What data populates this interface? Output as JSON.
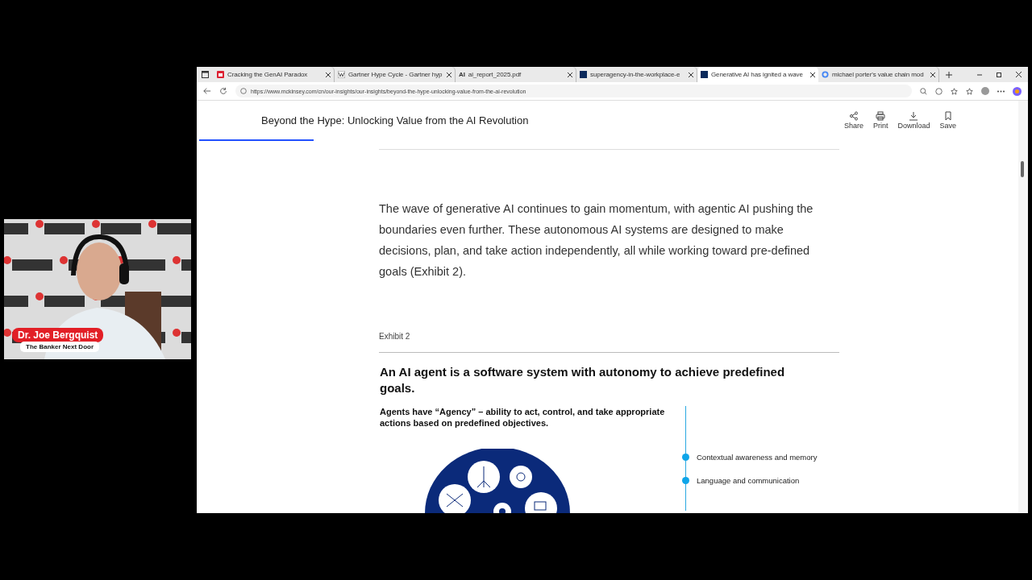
{
  "webcam": {
    "kind": "picture",
    "name": "Dr. Joe Bergquist",
    "show": "The Banker Next Door"
  },
  "browser": {
    "tabs": [
      {
        "title": "Cracking the GenAI Paradox",
        "kind": "pdf",
        "selected": false
      },
      {
        "title": "Gartner Hype Cycle - Gartner hyp",
        "kind": "wiki",
        "selected": false
      },
      {
        "title": "ai_report_2025.pdf",
        "kind": "text",
        "favicon_text": "AI",
        "selected": false
      },
      {
        "title": "superagency-in-the-workplace-e",
        "kind": "square",
        "selected": false
      },
      {
        "title": "Generative AI has ignited a wave",
        "kind": "square",
        "selected": true
      },
      {
        "title": "michael porter's value chain mod",
        "kind": "google",
        "selected": false
      }
    ],
    "url": "https://www.mckinsey.com/cn/our-insights/our-insights/beyond-the-hype-unlocking-value-from-the-ai-revolution"
  },
  "page": {
    "title": "Beyond the Hype: Unlocking Value from the AI Revolution",
    "reading_progress": {
      "level": 0.14
    },
    "actions": [
      {
        "label": "Share",
        "kind": "share"
      },
      {
        "label": "Print",
        "kind": "print"
      },
      {
        "label": "Download",
        "kind": "download"
      },
      {
        "label": "Save",
        "kind": "save"
      }
    ],
    "paragraph": "The wave of generative AI continues to gain momentum, with agentic AI pushing the boundaries even further. These autonomous AI systems are designed to make decisions, plan, and take action independently, all while working toward pre-defined goals (Exhibit 2).",
    "exhibit": {
      "label": "Exhibit 2",
      "heading": "An AI agent is a software system with autonomy to achieve predefined goals.",
      "subheading": "Agents have “Agency” –  ability to act, control, and take appropriate actions based on predefined objectives.",
      "capabilities": [
        "Contextual awareness and memory",
        "Language and communication"
      ]
    }
  }
}
